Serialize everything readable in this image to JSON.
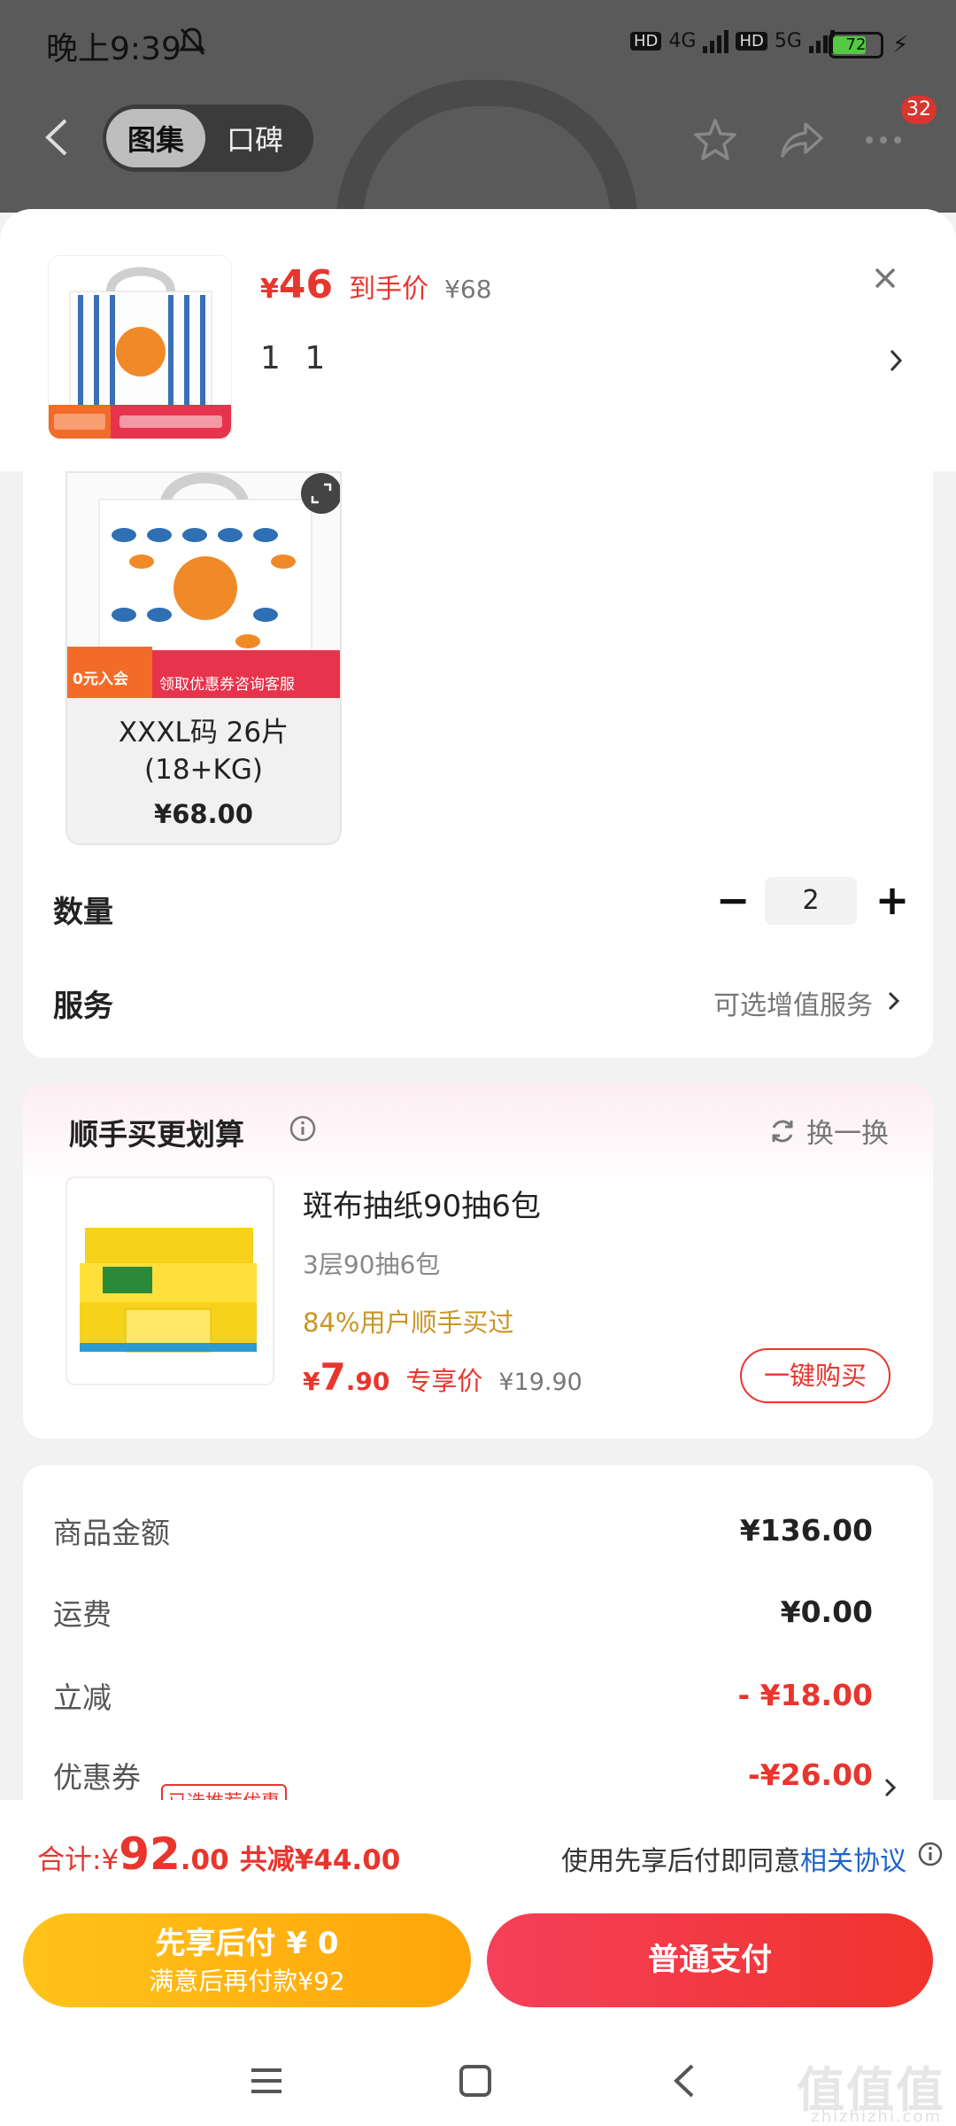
{
  "status_bar": {
    "time": "晚上9:39",
    "hd1": "HD",
    "net1": "4G",
    "hd2": "HD",
    "net2": "5G",
    "battery": "72",
    "battery_level": 0.72
  },
  "nav": {
    "tab_active": "图集",
    "tab_inactive": "口碑",
    "cart_badge": "32"
  },
  "header": {
    "price_symbol": "¥",
    "price": "46",
    "price_label": "到手价",
    "original_price": "¥68",
    "selection": "1 1"
  },
  "sku": {
    "name": "XXXL码 26片 (18+KG)",
    "price": "¥68.00",
    "image_promo_left": "0元入会",
    "image_promo_right": "领取优惠券咨询客服"
  },
  "quantity": {
    "label": "数量",
    "minus": "−",
    "value": "2",
    "plus": "+"
  },
  "service": {
    "label": "服务",
    "value": "可选增值服务"
  },
  "addon": {
    "title": "顺手买更划算",
    "swap_label": "换一换",
    "product_name": "斑布抽纸90抽6包",
    "spec": "3层90抽6包",
    "bought_ratio": "84%用户顺手买过",
    "price_symbol": "¥",
    "price_int": "7",
    "price_dec": ".90",
    "price_label": "专享价",
    "original_price": "¥19.90",
    "buy_button": "一键购买"
  },
  "summary": {
    "rows": [
      {
        "label": "商品金额",
        "value": "¥136.00"
      },
      {
        "label": "运费",
        "value": "¥0.00"
      },
      {
        "label": "立减",
        "value": "- ¥18.00"
      },
      {
        "label": "优惠券",
        "value": "-¥26.00",
        "tag": "已选推荐优惠"
      }
    ]
  },
  "footer": {
    "total_label": "合计: ",
    "total_currency": "¥",
    "total_int": "92",
    "total_dec": ".00",
    "total_saved": "共减¥44.00",
    "agree_text": "使用先享后付即同意",
    "agree_link": "相关协议",
    "pay_later_title": "先享后付 ¥ 0",
    "pay_later_sub": "满意后再付款¥92",
    "pay_normal": "普通支付"
  },
  "watermark": {
    "text": "值值值",
    "sub": "zhizhizhi.com"
  },
  "colors": {
    "accent_red": "#e8352e",
    "pay_later_yellow": "#ffb60f",
    "link_blue": "#1d63c9",
    "buy_ratio_gold": "#c99526"
  }
}
